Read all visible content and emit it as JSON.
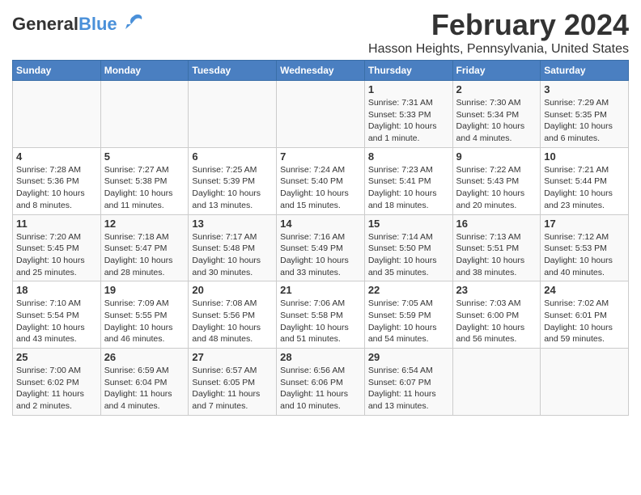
{
  "header": {
    "logo_general": "General",
    "logo_blue": "Blue",
    "main_title": "February 2024",
    "subtitle": "Hasson Heights, Pennsylvania, United States"
  },
  "calendar": {
    "days_of_week": [
      "Sunday",
      "Monday",
      "Tuesday",
      "Wednesday",
      "Thursday",
      "Friday",
      "Saturday"
    ],
    "weeks": [
      [
        {
          "date": "",
          "info": ""
        },
        {
          "date": "",
          "info": ""
        },
        {
          "date": "",
          "info": ""
        },
        {
          "date": "",
          "info": ""
        },
        {
          "date": "1",
          "info": "Sunrise: 7:31 AM\nSunset: 5:33 PM\nDaylight: 10 hours\nand 1 minute."
        },
        {
          "date": "2",
          "info": "Sunrise: 7:30 AM\nSunset: 5:34 PM\nDaylight: 10 hours\nand 4 minutes."
        },
        {
          "date": "3",
          "info": "Sunrise: 7:29 AM\nSunset: 5:35 PM\nDaylight: 10 hours\nand 6 minutes."
        }
      ],
      [
        {
          "date": "4",
          "info": "Sunrise: 7:28 AM\nSunset: 5:36 PM\nDaylight: 10 hours\nand 8 minutes."
        },
        {
          "date": "5",
          "info": "Sunrise: 7:27 AM\nSunset: 5:38 PM\nDaylight: 10 hours\nand 11 minutes."
        },
        {
          "date": "6",
          "info": "Sunrise: 7:25 AM\nSunset: 5:39 PM\nDaylight: 10 hours\nand 13 minutes."
        },
        {
          "date": "7",
          "info": "Sunrise: 7:24 AM\nSunset: 5:40 PM\nDaylight: 10 hours\nand 15 minutes."
        },
        {
          "date": "8",
          "info": "Sunrise: 7:23 AM\nSunset: 5:41 PM\nDaylight: 10 hours\nand 18 minutes."
        },
        {
          "date": "9",
          "info": "Sunrise: 7:22 AM\nSunset: 5:43 PM\nDaylight: 10 hours\nand 20 minutes."
        },
        {
          "date": "10",
          "info": "Sunrise: 7:21 AM\nSunset: 5:44 PM\nDaylight: 10 hours\nand 23 minutes."
        }
      ],
      [
        {
          "date": "11",
          "info": "Sunrise: 7:20 AM\nSunset: 5:45 PM\nDaylight: 10 hours\nand 25 minutes."
        },
        {
          "date": "12",
          "info": "Sunrise: 7:18 AM\nSunset: 5:47 PM\nDaylight: 10 hours\nand 28 minutes."
        },
        {
          "date": "13",
          "info": "Sunrise: 7:17 AM\nSunset: 5:48 PM\nDaylight: 10 hours\nand 30 minutes."
        },
        {
          "date": "14",
          "info": "Sunrise: 7:16 AM\nSunset: 5:49 PM\nDaylight: 10 hours\nand 33 minutes."
        },
        {
          "date": "15",
          "info": "Sunrise: 7:14 AM\nSunset: 5:50 PM\nDaylight: 10 hours\nand 35 minutes."
        },
        {
          "date": "16",
          "info": "Sunrise: 7:13 AM\nSunset: 5:51 PM\nDaylight: 10 hours\nand 38 minutes."
        },
        {
          "date": "17",
          "info": "Sunrise: 7:12 AM\nSunset: 5:53 PM\nDaylight: 10 hours\nand 40 minutes."
        }
      ],
      [
        {
          "date": "18",
          "info": "Sunrise: 7:10 AM\nSunset: 5:54 PM\nDaylight: 10 hours\nand 43 minutes."
        },
        {
          "date": "19",
          "info": "Sunrise: 7:09 AM\nSunset: 5:55 PM\nDaylight: 10 hours\nand 46 minutes."
        },
        {
          "date": "20",
          "info": "Sunrise: 7:08 AM\nSunset: 5:56 PM\nDaylight: 10 hours\nand 48 minutes."
        },
        {
          "date": "21",
          "info": "Sunrise: 7:06 AM\nSunset: 5:58 PM\nDaylight: 10 hours\nand 51 minutes."
        },
        {
          "date": "22",
          "info": "Sunrise: 7:05 AM\nSunset: 5:59 PM\nDaylight: 10 hours\nand 54 minutes."
        },
        {
          "date": "23",
          "info": "Sunrise: 7:03 AM\nSunset: 6:00 PM\nDaylight: 10 hours\nand 56 minutes."
        },
        {
          "date": "24",
          "info": "Sunrise: 7:02 AM\nSunset: 6:01 PM\nDaylight: 10 hours\nand 59 minutes."
        }
      ],
      [
        {
          "date": "25",
          "info": "Sunrise: 7:00 AM\nSunset: 6:02 PM\nDaylight: 11 hours\nand 2 minutes."
        },
        {
          "date": "26",
          "info": "Sunrise: 6:59 AM\nSunset: 6:04 PM\nDaylight: 11 hours\nand 4 minutes."
        },
        {
          "date": "27",
          "info": "Sunrise: 6:57 AM\nSunset: 6:05 PM\nDaylight: 11 hours\nand 7 minutes."
        },
        {
          "date": "28",
          "info": "Sunrise: 6:56 AM\nSunset: 6:06 PM\nDaylight: 11 hours\nand 10 minutes."
        },
        {
          "date": "29",
          "info": "Sunrise: 6:54 AM\nSunset: 6:07 PM\nDaylight: 11 hours\nand 13 minutes."
        },
        {
          "date": "",
          "info": ""
        },
        {
          "date": "",
          "info": ""
        }
      ]
    ]
  }
}
